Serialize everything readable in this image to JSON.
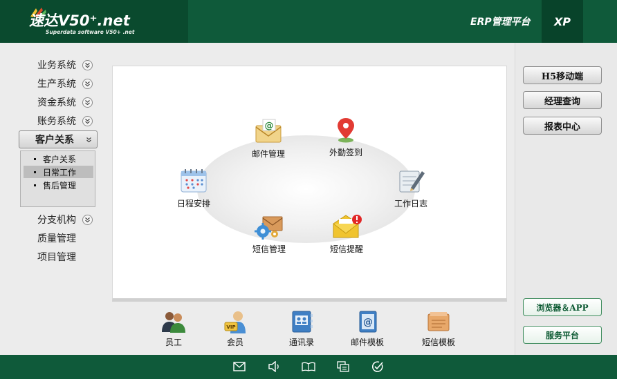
{
  "header": {
    "logo_title": "速达V50⁺.net",
    "logo_subtitle": "Superdata software V50+ .net",
    "platform_label": "ERP管理平台",
    "edition_label": "XP"
  },
  "nav": {
    "items": [
      {
        "label": "业务系统"
      },
      {
        "label": "生产系统"
      },
      {
        "label": "资金系统"
      },
      {
        "label": "账务系统"
      },
      {
        "label": "客户关系"
      },
      {
        "label": "分支机构"
      },
      {
        "label": "质量管理"
      },
      {
        "label": "项目管理"
      }
    ],
    "submenu": [
      {
        "label": "客户关系"
      },
      {
        "label": "日常工作"
      },
      {
        "label": "售后管理"
      }
    ]
  },
  "hub": {
    "items": [
      {
        "label": "邮件管理",
        "icon": "mail-envelope-icon"
      },
      {
        "label": "外勤签到",
        "icon": "map-pin-icon"
      },
      {
        "label": "日程安排",
        "icon": "calendar-icon"
      },
      {
        "label": "工作日志",
        "icon": "notebook-pen-icon"
      },
      {
        "label": "短信管理",
        "icon": "sms-gear-icon"
      },
      {
        "label": "短信提醒",
        "icon": "sms-alert-icon"
      }
    ]
  },
  "toolbar": {
    "items": [
      {
        "label": "员工",
        "icon": "employees-icon"
      },
      {
        "label": "会员",
        "icon": "vip-member-icon"
      },
      {
        "label": "通讯录",
        "icon": "address-book-icon"
      },
      {
        "label": "邮件模板",
        "icon": "mail-template-icon"
      },
      {
        "label": "短信模板",
        "icon": "sms-template-icon"
      }
    ]
  },
  "right_panel": {
    "buttons": [
      {
        "label": "H5移动端"
      },
      {
        "label": "经理查询"
      },
      {
        "label": "报表中心"
      }
    ],
    "bottom_buttons": [
      {
        "label": "浏览器＆APP"
      },
      {
        "label": "服务平台"
      }
    ]
  },
  "footer": {
    "icons": [
      "mail-icon",
      "speaker-icon",
      "book-icon",
      "messages-icon",
      "check-circle-icon"
    ]
  },
  "colors": {
    "header_green": "#0f5a3a",
    "accent_green": "#0d5a33"
  }
}
